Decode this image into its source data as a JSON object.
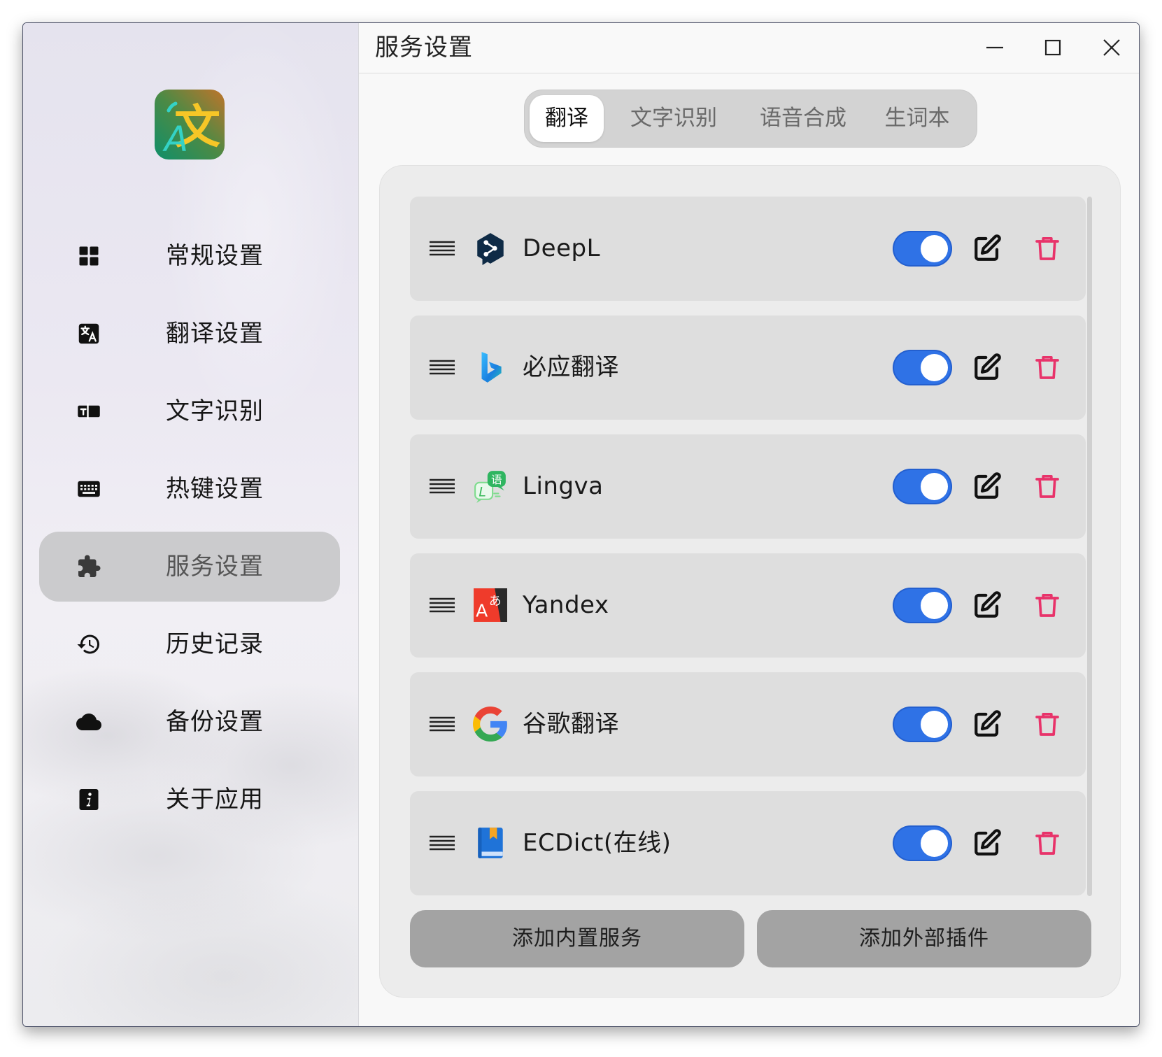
{
  "window": {
    "title": "服务设置",
    "controls": [
      "minimize-icon",
      "maximize-icon",
      "close-icon"
    ]
  },
  "app_logo": {
    "icon": "app-logo-icon",
    "glyph_main": "文",
    "glyph_sub": "A"
  },
  "sidebar": {
    "active_index": 4,
    "items": [
      {
        "label": "常规设置",
        "icon": "grid-icon"
      },
      {
        "label": "翻译设置",
        "icon": "translate-icon"
      },
      {
        "label": "文字识别",
        "icon": "ocr-icon"
      },
      {
        "label": "热键设置",
        "icon": "keyboard-icon"
      },
      {
        "label": "服务设置",
        "icon": "puzzle-icon"
      },
      {
        "label": "历史记录",
        "icon": "history-icon"
      },
      {
        "label": "备份设置",
        "icon": "cloud-icon"
      },
      {
        "label": "关于应用",
        "icon": "info-icon"
      }
    ]
  },
  "tabs": [
    {
      "label": "翻译",
      "active": true
    },
    {
      "label": "文字识别",
      "active": false
    },
    {
      "label": "语音合成",
      "active": false
    },
    {
      "label": "生词本",
      "active": false
    }
  ],
  "services": [
    {
      "name": "DeepL",
      "icon": "deepl-logo-icon",
      "enabled": true
    },
    {
      "name": "必应翻译",
      "icon": "bing-logo-icon",
      "enabled": true
    },
    {
      "name": "Lingva",
      "icon": "lingva-logo-icon",
      "enabled": true
    },
    {
      "name": "Yandex",
      "icon": "yandex-logo-icon",
      "enabled": true
    },
    {
      "name": "谷歌翻译",
      "icon": "google-logo-icon",
      "enabled": true
    },
    {
      "name": "ECDict(在线)",
      "icon": "ecdict-logo-icon",
      "enabled": true
    }
  ],
  "row_icons": {
    "drag": "drag-handle-icon",
    "edit": "edit-icon",
    "delete": "delete-icon"
  },
  "logo_lettering": {
    "lingva": [
      "语",
      "L"
    ],
    "yandex": [
      "A",
      "あ"
    ]
  },
  "buttons": {
    "add_builtin": "添加内置服务",
    "add_plugin": "添加外部插件"
  },
  "colors": {
    "toggle_on": "#2f72e6",
    "delete_red": "#e8336a",
    "nav_active_bg": "#cbcbcd",
    "button_bg": "#a3a3a3"
  }
}
